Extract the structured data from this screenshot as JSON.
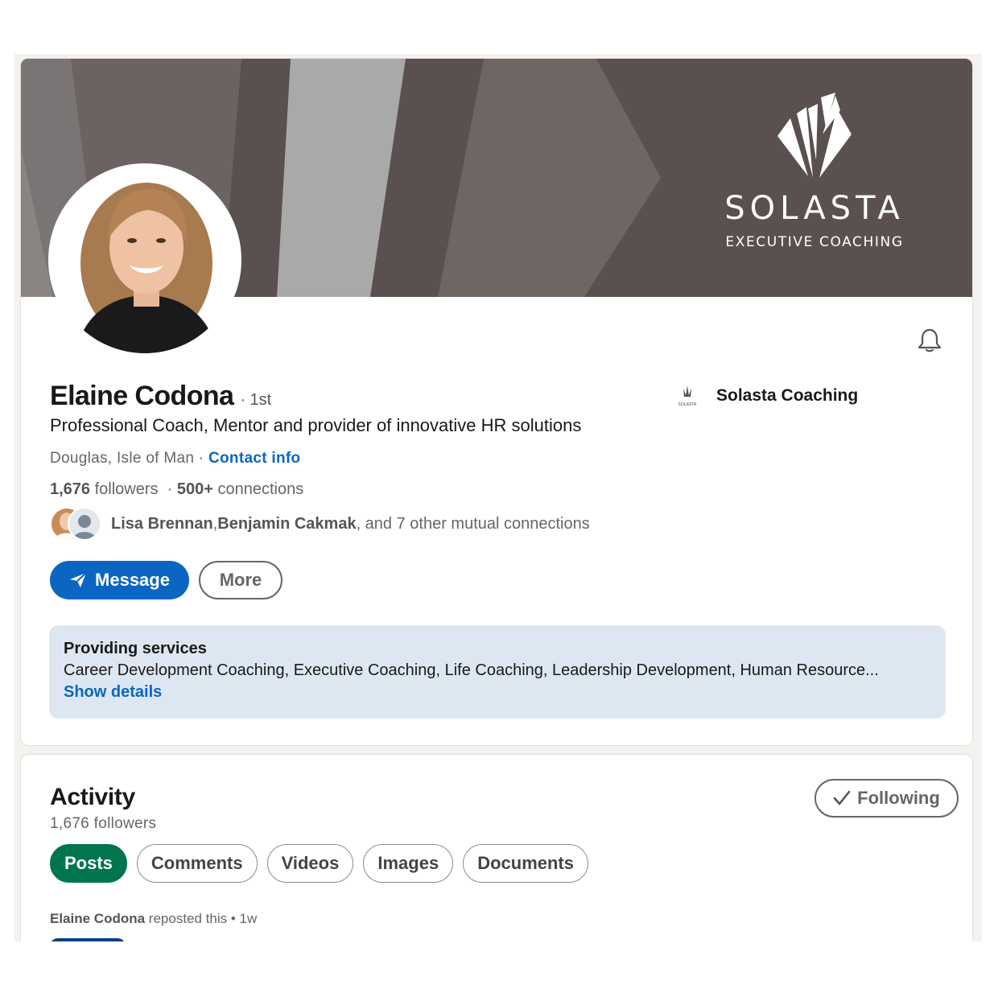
{
  "banner": {
    "brand_name": "SOLASTA",
    "brand_tagline": "EXECUTIVE COACHING",
    "colors": {
      "dark": "#59504f",
      "mid": "#6f6562",
      "light": "#a9a9a9",
      "shade": "#8a8583"
    }
  },
  "profile": {
    "name": "Elaine Codona",
    "degree": "· 1st",
    "headline": "Professional Coach, Mentor and provider of innovative HR solutions",
    "location": "Douglas, Isle of Man",
    "separator": " · ",
    "contact_label": "Contact info",
    "followers_count": "1,676",
    "followers_label": " followers",
    "connections_prefix": "· ",
    "connections_count": "500+",
    "connections_label": " connections",
    "company_name": "Solasta Coaching",
    "company_logo_text": "SOLASTA",
    "bell_icon": "bell-icon"
  },
  "mutual": {
    "name1": "Lisa Brennan",
    "comma": ", ",
    "name2": "Benjamin Cakmak",
    "rest": ", and 7 other mutual connections"
  },
  "actions": {
    "message_label": "Message",
    "more_label": "More"
  },
  "services": {
    "title": "Providing services",
    "list": "Career Development Coaching, Executive Coaching, Life Coaching, Leadership Development, Human Resource...",
    "link": "Show details"
  },
  "activity": {
    "title": "Activity",
    "followers": "1,676 followers",
    "following_label": "Following",
    "tabs": [
      "Posts",
      "Comments",
      "Videos",
      "Images",
      "Documents"
    ],
    "repost_name": "Elaine Codona",
    "repost_text": " reposted this • 1w"
  },
  "colors": {
    "primary": "#0a66c2",
    "active_pill": "#01754f",
    "services_bg": "#dde7f1"
  }
}
